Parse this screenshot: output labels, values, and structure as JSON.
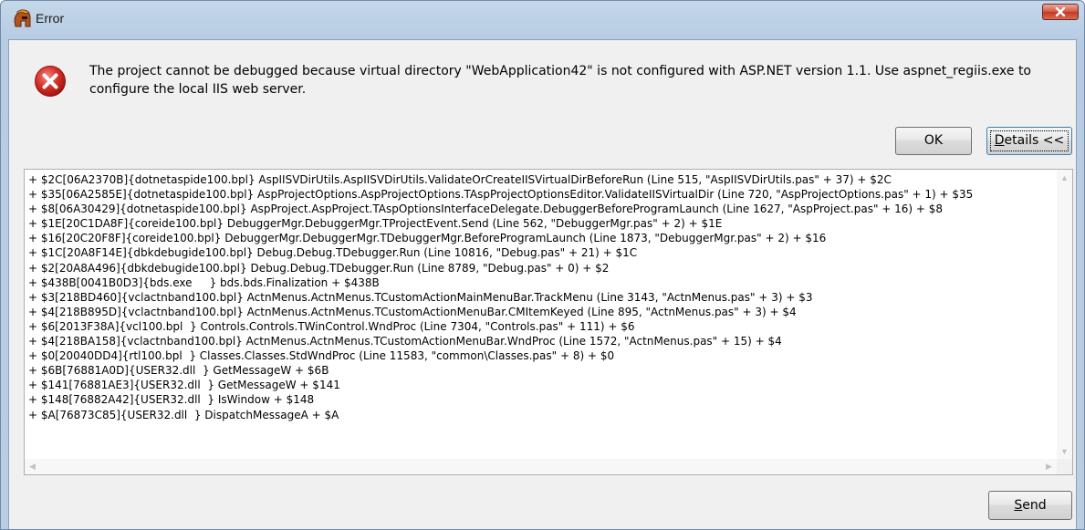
{
  "window": {
    "title": "Error",
    "close_icon": "close-icon",
    "app_icon": "spartan-helmet-icon"
  },
  "message": {
    "icon": "error-x-icon",
    "text": "The project cannot be debugged because virtual directory \"WebApplication42\" is not configured with ASP.NET version 1.1.  Use aspnet_regiis.exe to configure the local IIS web server."
  },
  "buttons": {
    "ok": "OK",
    "details_prefix": "D",
    "details_rest": "etails <<",
    "send_prefix": "S",
    "send_rest": "end"
  },
  "details": {
    "lines": [
      "+ $2C[06A2370B]{dotnetaspide100.bpl} AspIISVDirUtils.AspIISVDirUtils.ValidateOrCreateIISVirtualDirBeforeRun (Line 515, \"AspIISVDirUtils.pas\" + 37) + $2C",
      "+ $35[06A2585E]{dotnetaspide100.bpl} AspProjectOptions.AspProjectOptions.TAspProjectOptionsEditor.ValidateIISVirtualDir (Line 720, \"AspProjectOptions.pas\" + 1) + $35",
      "+ $8[06A30429]{dotnetaspide100.bpl} AspProject.AspProject.TAspOptionsInterfaceDelegate.DebuggerBeforeProgramLaunch (Line 1627, \"AspProject.pas\" + 16) + $8",
      "+ $1E[20C1DA8F]{coreide100.bpl} DebuggerMgr.DebuggerMgr.TProjectEvent.Send (Line 562, \"DebuggerMgr.pas\" + 2) + $1E",
      "+ $16[20C20F8F]{coreide100.bpl} DebuggerMgr.DebuggerMgr.TDebuggerMgr.BeforeProgramLaunch (Line 1873, \"DebuggerMgr.pas\" + 2) + $16",
      "+ $1C[20A8F14E]{dbkdebugide100.bpl} Debug.Debug.TDebugger.Run (Line 10816, \"Debug.pas\" + 21) + $1C",
      "+ $2[20A8A496]{dbkdebugide100.bpl} Debug.Debug.TDebugger.Run (Line 8789, \"Debug.pas\" + 0) + $2",
      "+ $438B[0041B0D3]{bds.exe     } bds.bds.Finalization + $438B",
      "+ $3[218BD460]{vclactnband100.bpl} ActnMenus.ActnMenus.TCustomActionMainMenuBar.TrackMenu (Line 3143, \"ActnMenus.pas\" + 3) + $3",
      "+ $4[218B895D]{vclactnband100.bpl} ActnMenus.ActnMenus.TCustomActionMenuBar.CMItemKeyed (Line 895, \"ActnMenus.pas\" + 3) + $4",
      "+ $6[2013F38A]{vcl100.bpl  } Controls.Controls.TWinControl.WndProc (Line 7304, \"Controls.pas\" + 111) + $6",
      "+ $4[218BA158]{vclactnband100.bpl} ActnMenus.ActnMenus.TCustomActionMenuBar.WndProc (Line 1572, \"ActnMenus.pas\" + 15) + $4",
      "+ $0[20040DD4]{rtl100.bpl  } Classes.Classes.StdWndProc (Line 11583, \"common\\Classes.pas\" + 8) + $0",
      "+ $6B[76881A0D]{USER32.dll  } GetMessageW + $6B",
      "+ $141[76881AE3]{USER32.dll  } GetMessageW + $141",
      "+ $148[76882A42]{USER32.dll  } IsWindow + $148",
      "+ $A[76873C85]{USER32.dll  } DispatchMessageA + $A"
    ]
  }
}
